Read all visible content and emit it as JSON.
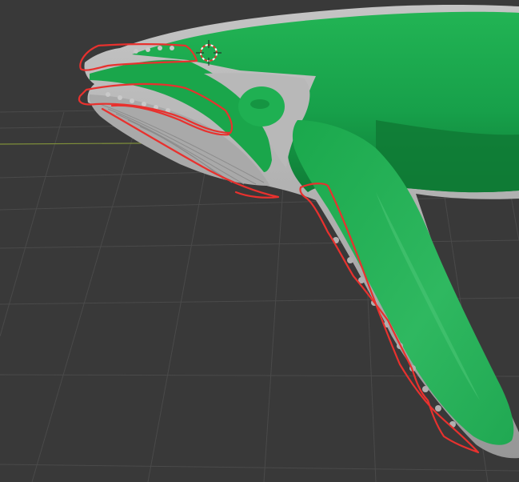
{
  "viewport": {
    "background_color": "#393939",
    "grid_color": "#4a4a4a",
    "horizon_axis_color": "#7f8f3a"
  },
  "model": {
    "name": "whale",
    "body_color": "#19a84c",
    "body_shade_color": "#12803a",
    "body_highlight_color": "#3fc06b",
    "secondary_color": "#b5b5b5",
    "secondary_shade_color": "#9a9a9a"
  },
  "annotations": {
    "stroke_color": "#e8312e"
  },
  "cursor_3d": {
    "icon": "3d-cursor-icon",
    "ring_color_a": "#ffffff",
    "ring_color_b": "#d0402e"
  }
}
